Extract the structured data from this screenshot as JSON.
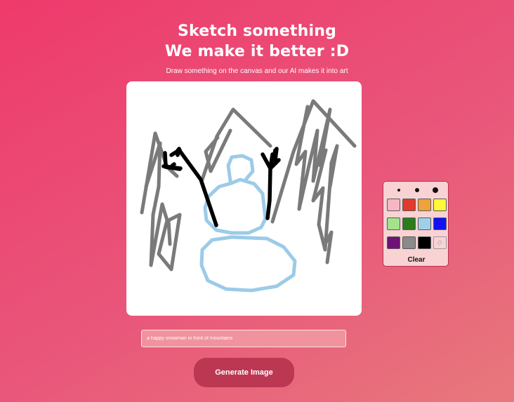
{
  "header": {
    "title_line1": "Sketch something",
    "title_line2": "We make it better :D",
    "subtitle": "Draw something on the canvas and our AI makes it into art"
  },
  "canvas": {
    "drawing": "snowman in front of mountains sketch",
    "background_color": "#ffffff"
  },
  "palette": {
    "brush_sizes": [
      "small",
      "medium",
      "large"
    ],
    "colors": [
      "#f6b7c4",
      "#e13a2c",
      "#f0a23a",
      "#fff73a",
      "#a3e38c",
      "#2c7c1c",
      "#a2cfe8",
      "#1212f0",
      "#6e1278",
      "#8a8a8a",
      "#000000"
    ],
    "eraser_icon": "eraser-icon",
    "clear_label": "Clear"
  },
  "prompt": {
    "value": "a happy snowman in front of mountains",
    "placeholder": ""
  },
  "generate_button": {
    "label": "Generate Image"
  },
  "colors": {
    "background_start": "#ee3a6c",
    "background_end": "#e8787c",
    "button": "#bb3752",
    "palette_panel": "#f9d2d4",
    "stroke_gray": "#7a7a7a",
    "stroke_blue": "#9ccbe8",
    "stroke_black": "#000000"
  }
}
